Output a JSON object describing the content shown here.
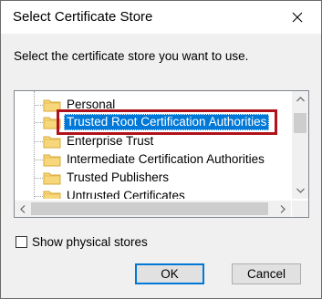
{
  "window": {
    "title": "Select Certificate Store",
    "close_icon": "close-icon"
  },
  "prompt": "Select the certificate store you want to use.",
  "stores": [
    {
      "label": "Personal",
      "selected": false
    },
    {
      "label": "Trusted Root Certification Authorities",
      "selected": true
    },
    {
      "label": "Enterprise Trust",
      "selected": false
    },
    {
      "label": "Intermediate Certification Authorities",
      "selected": false
    },
    {
      "label": "Trusted Publishers",
      "selected": false
    },
    {
      "label": "Untrusted Certificates",
      "selected": false
    }
  ],
  "show_physical": {
    "label": "Show physical stores",
    "checked": false
  },
  "buttons": {
    "ok": "OK",
    "cancel": "Cancel"
  },
  "colors": {
    "selection": "#0078d7",
    "annotation_box": "#b0121b",
    "folder": "#f6d77c"
  }
}
